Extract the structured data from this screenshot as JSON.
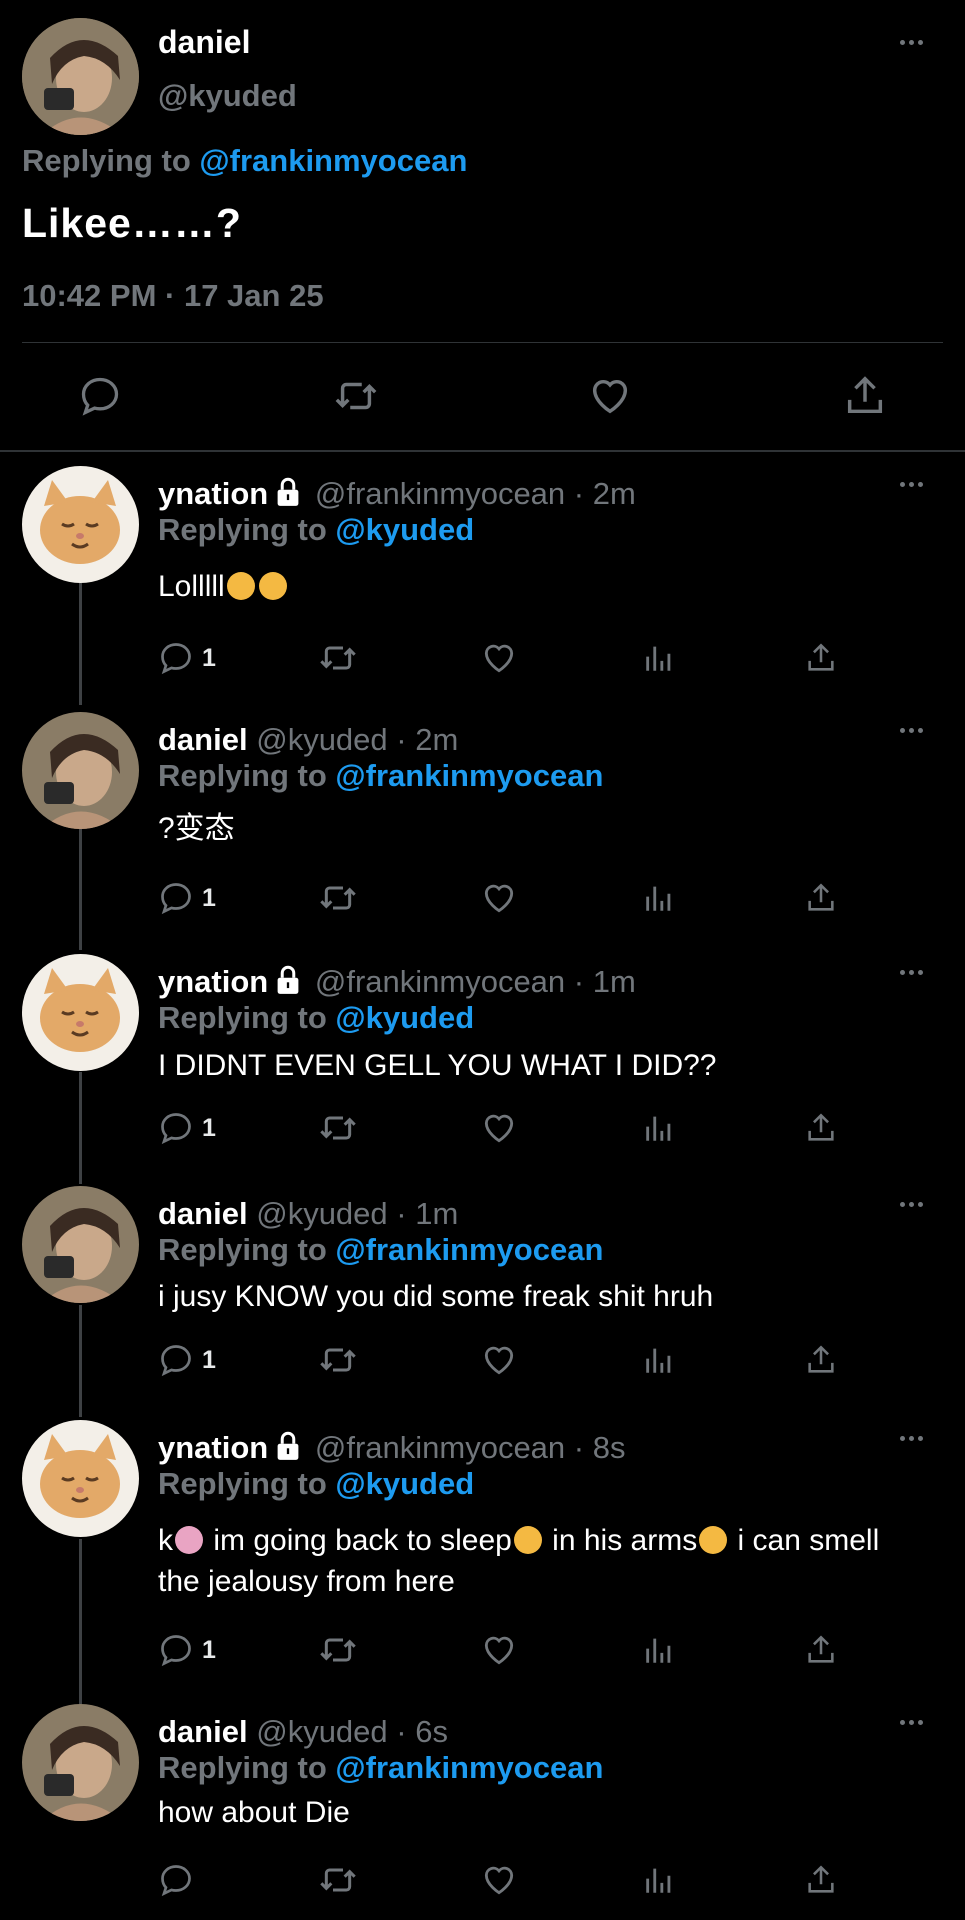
{
  "colors": {
    "accent": "#1d9bf0",
    "muted": "#71767b",
    "text": "#ffffff",
    "background": "#000000"
  },
  "main_tweet": {
    "name": "daniel",
    "handle": "@kyuded",
    "replying_label": "Replying to",
    "replying_mention": "@frankinmyocean",
    "text": "Likee……?",
    "timestamp": "10:42 PM · 17 Jan 25",
    "actions": [
      "reply-icon",
      "retweet-icon",
      "like-icon",
      "share-icon"
    ]
  },
  "replies": [
    {
      "name": "ynation",
      "locked": true,
      "handle_time": "@frankinmyocean · 2m",
      "replying_label": "Replying to",
      "replying_mention": "@kyuded",
      "text": "Lolllll",
      "reply_count": "1",
      "avatar": "cat-avatar"
    },
    {
      "name": "daniel",
      "locked": false,
      "handle_time": "@kyuded · 2m",
      "replying_label": "Replying to",
      "replying_mention": "@frankinmyocean",
      "text": "?变态",
      "reply_count": "1",
      "avatar": "daniel-avatar"
    },
    {
      "name": "ynation",
      "locked": true,
      "handle_time": "@frankinmyocean · 1m",
      "replying_label": "Replying to",
      "replying_mention": "@kyuded",
      "text": "I DIDNT EVEN GELL YOU WHAT I DID??",
      "reply_count": "1",
      "avatar": "cat-avatar"
    },
    {
      "name": "daniel",
      "locked": false,
      "handle_time": "@kyuded · 1m",
      "replying_label": "Replying to",
      "replying_mention": "@frankinmyocean",
      "text": "i jusy KNOW you did some freak shit hruh",
      "reply_count": "1",
      "avatar": "daniel-avatar"
    },
    {
      "name": "ynation",
      "locked": true,
      "handle_time": "@frankinmyocean · 8s",
      "replying_label": "Replying to",
      "replying_mention": "@kyuded",
      "text_parts": [
        "k",
        " im going back to sleep",
        " in his arms",
        "  i can smell the jealousy from here"
      ],
      "reply_count": "1",
      "avatar": "cat-avatar"
    },
    {
      "name": "daniel",
      "locked": false,
      "handle_time": "@kyuded · 6s",
      "replying_label": "Replying to",
      "replying_mention": "@frankinmyocean",
      "text": "how about Die",
      "reply_count": "",
      "avatar": "daniel-avatar"
    }
  ]
}
